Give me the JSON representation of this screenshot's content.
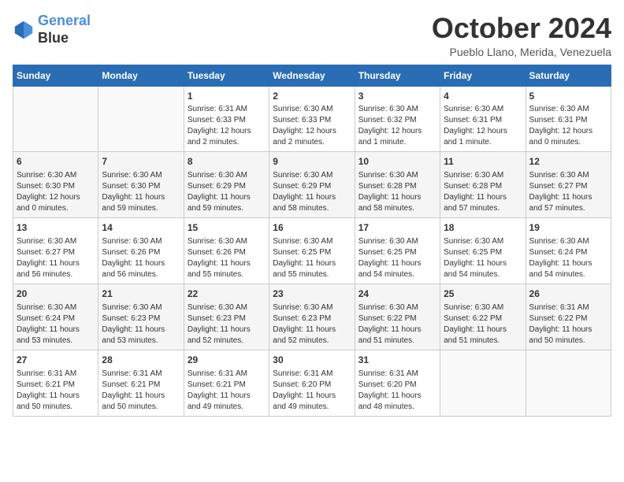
{
  "header": {
    "logo_line1": "General",
    "logo_line2": "Blue",
    "month_title": "October 2024",
    "location": "Pueblo Llano, Merida, Venezuela"
  },
  "days_of_week": [
    "Sunday",
    "Monday",
    "Tuesday",
    "Wednesday",
    "Thursday",
    "Friday",
    "Saturday"
  ],
  "weeks": [
    [
      {
        "day": "",
        "info": ""
      },
      {
        "day": "",
        "info": ""
      },
      {
        "day": "1",
        "info": "Sunrise: 6:31 AM\nSunset: 6:33 PM\nDaylight: 12 hours\nand 2 minutes."
      },
      {
        "day": "2",
        "info": "Sunrise: 6:30 AM\nSunset: 6:33 PM\nDaylight: 12 hours\nand 2 minutes."
      },
      {
        "day": "3",
        "info": "Sunrise: 6:30 AM\nSunset: 6:32 PM\nDaylight: 12 hours\nand 1 minute."
      },
      {
        "day": "4",
        "info": "Sunrise: 6:30 AM\nSunset: 6:31 PM\nDaylight: 12 hours\nand 1 minute."
      },
      {
        "day": "5",
        "info": "Sunrise: 6:30 AM\nSunset: 6:31 PM\nDaylight: 12 hours\nand 0 minutes."
      }
    ],
    [
      {
        "day": "6",
        "info": "Sunrise: 6:30 AM\nSunset: 6:30 PM\nDaylight: 12 hours\nand 0 minutes."
      },
      {
        "day": "7",
        "info": "Sunrise: 6:30 AM\nSunset: 6:30 PM\nDaylight: 11 hours\nand 59 minutes."
      },
      {
        "day": "8",
        "info": "Sunrise: 6:30 AM\nSunset: 6:29 PM\nDaylight: 11 hours\nand 59 minutes."
      },
      {
        "day": "9",
        "info": "Sunrise: 6:30 AM\nSunset: 6:29 PM\nDaylight: 11 hours\nand 58 minutes."
      },
      {
        "day": "10",
        "info": "Sunrise: 6:30 AM\nSunset: 6:28 PM\nDaylight: 11 hours\nand 58 minutes."
      },
      {
        "day": "11",
        "info": "Sunrise: 6:30 AM\nSunset: 6:28 PM\nDaylight: 11 hours\nand 57 minutes."
      },
      {
        "day": "12",
        "info": "Sunrise: 6:30 AM\nSunset: 6:27 PM\nDaylight: 11 hours\nand 57 minutes."
      }
    ],
    [
      {
        "day": "13",
        "info": "Sunrise: 6:30 AM\nSunset: 6:27 PM\nDaylight: 11 hours\nand 56 minutes."
      },
      {
        "day": "14",
        "info": "Sunrise: 6:30 AM\nSunset: 6:26 PM\nDaylight: 11 hours\nand 56 minutes."
      },
      {
        "day": "15",
        "info": "Sunrise: 6:30 AM\nSunset: 6:26 PM\nDaylight: 11 hours\nand 55 minutes."
      },
      {
        "day": "16",
        "info": "Sunrise: 6:30 AM\nSunset: 6:25 PM\nDaylight: 11 hours\nand 55 minutes."
      },
      {
        "day": "17",
        "info": "Sunrise: 6:30 AM\nSunset: 6:25 PM\nDaylight: 11 hours\nand 54 minutes."
      },
      {
        "day": "18",
        "info": "Sunrise: 6:30 AM\nSunset: 6:25 PM\nDaylight: 11 hours\nand 54 minutes."
      },
      {
        "day": "19",
        "info": "Sunrise: 6:30 AM\nSunset: 6:24 PM\nDaylight: 11 hours\nand 54 minutes."
      }
    ],
    [
      {
        "day": "20",
        "info": "Sunrise: 6:30 AM\nSunset: 6:24 PM\nDaylight: 11 hours\nand 53 minutes."
      },
      {
        "day": "21",
        "info": "Sunrise: 6:30 AM\nSunset: 6:23 PM\nDaylight: 11 hours\nand 53 minutes."
      },
      {
        "day": "22",
        "info": "Sunrise: 6:30 AM\nSunset: 6:23 PM\nDaylight: 11 hours\nand 52 minutes."
      },
      {
        "day": "23",
        "info": "Sunrise: 6:30 AM\nSunset: 6:23 PM\nDaylight: 11 hours\nand 52 minutes."
      },
      {
        "day": "24",
        "info": "Sunrise: 6:30 AM\nSunset: 6:22 PM\nDaylight: 11 hours\nand 51 minutes."
      },
      {
        "day": "25",
        "info": "Sunrise: 6:30 AM\nSunset: 6:22 PM\nDaylight: 11 hours\nand 51 minutes."
      },
      {
        "day": "26",
        "info": "Sunrise: 6:31 AM\nSunset: 6:22 PM\nDaylight: 11 hours\nand 50 minutes."
      }
    ],
    [
      {
        "day": "27",
        "info": "Sunrise: 6:31 AM\nSunset: 6:21 PM\nDaylight: 11 hours\nand 50 minutes."
      },
      {
        "day": "28",
        "info": "Sunrise: 6:31 AM\nSunset: 6:21 PM\nDaylight: 11 hours\nand 50 minutes."
      },
      {
        "day": "29",
        "info": "Sunrise: 6:31 AM\nSunset: 6:21 PM\nDaylight: 11 hours\nand 49 minutes."
      },
      {
        "day": "30",
        "info": "Sunrise: 6:31 AM\nSunset: 6:20 PM\nDaylight: 11 hours\nand 49 minutes."
      },
      {
        "day": "31",
        "info": "Sunrise: 6:31 AM\nSunset: 6:20 PM\nDaylight: 11 hours\nand 48 minutes."
      },
      {
        "day": "",
        "info": ""
      },
      {
        "day": "",
        "info": ""
      }
    ]
  ]
}
